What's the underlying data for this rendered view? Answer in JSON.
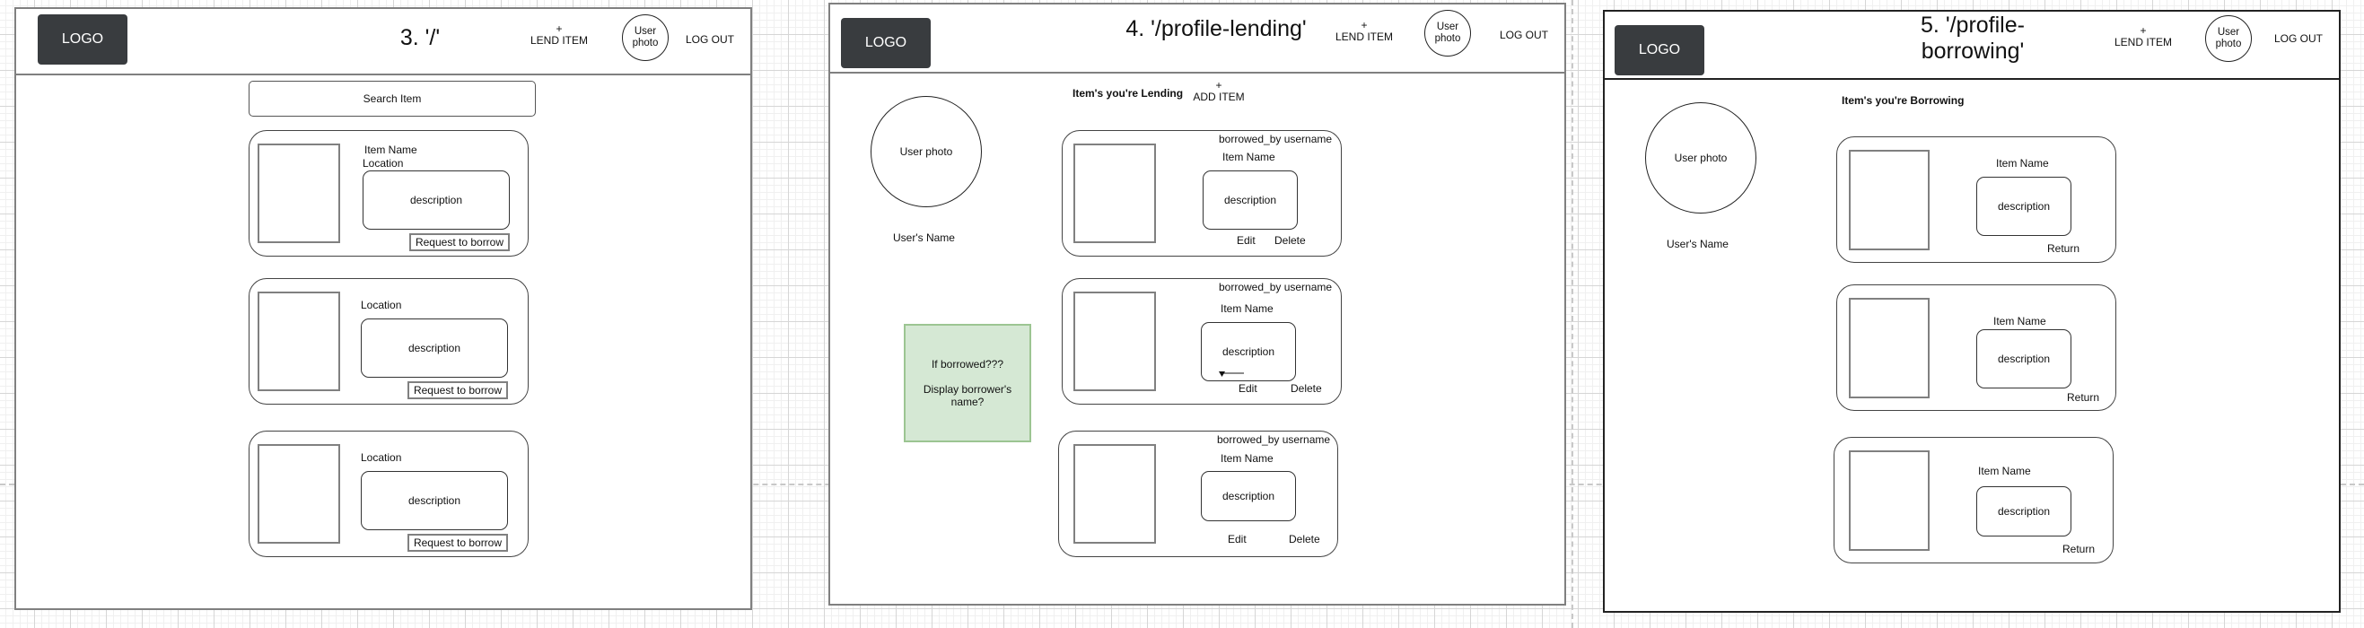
{
  "common": {
    "logo": "LOGO",
    "lend_plus": "+",
    "lend_label": "LEND ITEM",
    "user_photo_line1": "User",
    "user_photo_line2": "photo",
    "logout": "LOG OUT"
  },
  "screens": [
    {
      "title": "3. '/'",
      "search_label": "Search Item",
      "cards": [
        {
          "item_name": "Item Name",
          "location": "Location",
          "description": "description",
          "action": "Request to borrow"
        },
        {
          "location": "Location",
          "description": "description",
          "action": "Request to borrow"
        },
        {
          "location": "Location",
          "description": "description",
          "action": "Request to borrow"
        }
      ]
    },
    {
      "title": "4. '/profile-lending'",
      "profile": {
        "photo": "User photo",
        "name": "User's Name"
      },
      "section_heading": "Item's you're Lending",
      "add_plus": "+",
      "add_label": "ADD ITEM",
      "note": {
        "line1": "If borrowed???",
        "line2": "Display borrower's",
        "line3": "name?"
      },
      "cards": [
        {
          "borrowed_by": "borrowed_by username",
          "item_name": "Item Name",
          "description": "description",
          "edit": "Edit",
          "delete": "Delete"
        },
        {
          "borrowed_by": "borrowed_by username",
          "item_name": "Item Name",
          "description": "description",
          "edit": "Edit",
          "delete": "Delete"
        },
        {
          "borrowed_by": "borrowed_by username",
          "item_name": "Item Name",
          "description": "description",
          "edit": "Edit",
          "delete": "Delete"
        }
      ]
    },
    {
      "title_line1": "5. '/profile-",
      "title_line2": "borrowing'",
      "profile": {
        "photo": "User photo",
        "name": "User's Name"
      },
      "section_heading": "Item's you're Borrowing",
      "cards": [
        {
          "item_name": "Item Name",
          "description": "description",
          "action": "Return"
        },
        {
          "item_name": "Item Name",
          "description": "description",
          "action": "Return"
        },
        {
          "item_name": "Item Name",
          "description": "description",
          "action": "Return"
        }
      ]
    }
  ]
}
